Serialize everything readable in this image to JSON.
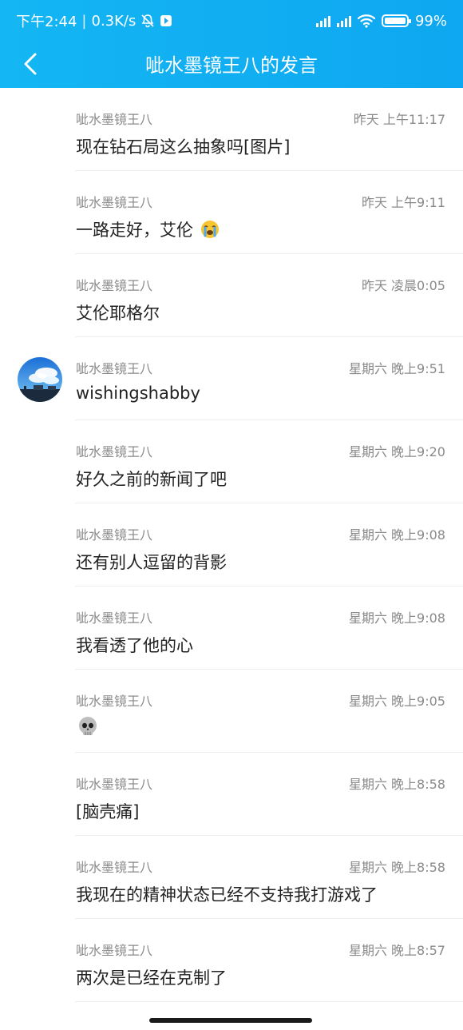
{
  "status": {
    "time": "下午2:44",
    "speed": "0.3K/s",
    "battery": "99%",
    "icons": [
      "bell-off-icon",
      "app-badge-icon",
      "signal-icon",
      "signal-icon",
      "wifi-icon",
      "battery-icon"
    ]
  },
  "nav": {
    "title": "呲水墨镜王八的发言",
    "back_icon": "chevron-left-icon"
  },
  "messages": [
    {
      "author": "呲水墨镜王八",
      "time": "昨天 上午11:17",
      "text": "现在钻石局这么抽象吗[图片]"
    },
    {
      "author": "呲水墨镜王八",
      "time": "昨天 上午9:11",
      "text": "一路走好，艾伦",
      "emoji": "crying-emoji"
    },
    {
      "author": "呲水墨镜王八",
      "time": "昨天 凌晨0:05",
      "text": "艾伦耶格尔"
    },
    {
      "author": "呲水墨镜王八",
      "time": "星期六 晚上9:51",
      "text": "wishingshabby",
      "avatar": "sky-cloud-avatar"
    },
    {
      "author": "呲水墨镜王八",
      "time": "星期六 晚上9:20",
      "text": "好久之前的新闻了吧"
    },
    {
      "author": "呲水墨镜王八",
      "time": "星期六 晚上9:08",
      "text": "还有别人逗留的背影"
    },
    {
      "author": "呲水墨镜王八",
      "time": "星期六 晚上9:08",
      "text": "我看透了他的心"
    },
    {
      "author": "呲水墨镜王八",
      "time": "星期六 晚上9:05",
      "text": "",
      "emoji": "skull-emoji"
    },
    {
      "author": "呲水墨镜王八",
      "time": "星期六 晚上8:58",
      "text": "[脑壳痛]"
    },
    {
      "author": "呲水墨镜王八",
      "time": "星期六 晚上8:58",
      "text": "我现在的精神状态已经不支持我打游戏了"
    },
    {
      "author": "呲水墨镜王八",
      "time": "星期六 晚上8:57",
      "text": "两次是已经在克制了"
    }
  ],
  "colors": {
    "header": "#0ea7f1",
    "meta_text": "#8a8a8a",
    "message_text": "#222222"
  }
}
